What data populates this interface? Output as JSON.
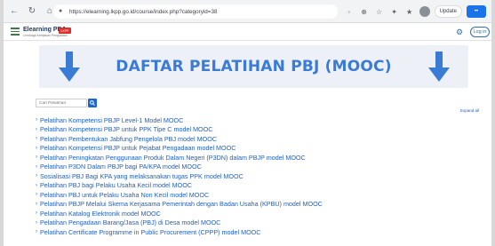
{
  "browser": {
    "url": "https://elearning.lkpp.go.id/course/index.php?categoryid=38",
    "update_label": "Update",
    "ext_label": "••"
  },
  "site": {
    "brand": "Elearning PBJ",
    "brand_sub": "Lembaga Kebijakan Pengadaan",
    "badge": "LKPP",
    "login_label": "Log in"
  },
  "banner": {
    "title": "DAFTAR PELATIHAN PBJ (MOOC)",
    "arrow_color": "#3a7bd5"
  },
  "search": {
    "placeholder": "Cari Pelatihan"
  },
  "expand_all": "Expand all",
  "courses": [
    "Pelatihan Kompetensi PBJP Level-1 Model MOOC",
    "Pelatihan Kompetensi PBJP untuk PPK Tipe C model MOOC",
    "Pelatihan Pembentukan Jabfung Pengelola PBJ model MOOC",
    "Pelatihan Kompetensi PBJP untuk Pejabat Pengadaan model MOOC",
    "Pelatihan Peningkatan Penggunaan Produk Dalam Negeri (P3DN) dalam PBJP model MOOC",
    "Pelatihan P3DN Dalam PBJP bagi PA/KPA model MOOC",
    "Sosialisasi PBJ Bagi KPA yang melaksanakan tugas PPK model MOOC",
    "Pelatihan PBJ bagi Pelaku Usaha Kecil model MOOC",
    "Pelatihan PBJ untuk Pelaku Usaha Non Kecil model MOOC",
    "Pelatihan PBJP Melalui Skema Kerjasama Pemerintah dengan Badan Usaha (KPBU) model MOOC",
    "Pelatihan Katalog Elektronik model MOOC",
    "Pelatihan Pengadaan Barang/Jasa (PBJ) di Desa model MOOC",
    "Pelatihan Certificate Programme in Public Procurement (CPPP) model MOOC"
  ]
}
